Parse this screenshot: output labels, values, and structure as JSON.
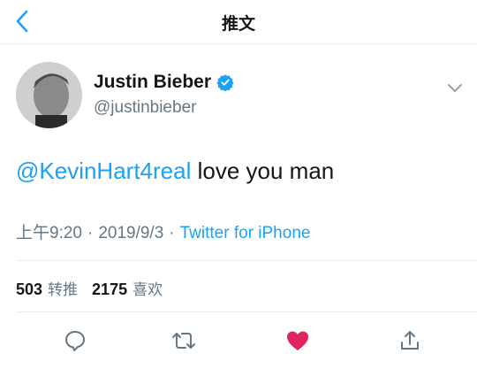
{
  "nav": {
    "title": "推文",
    "back_icon": "chevron-left-icon"
  },
  "author": {
    "name": "Justin Bieber",
    "handle": "@justinbieber",
    "verified": true,
    "verified_color": "#1da1f2"
  },
  "tweet": {
    "mention": "@KevinHart4real",
    "text": " love you man"
  },
  "meta": {
    "time": "上午9:20",
    "separator": "·",
    "date": "2019/9/3",
    "source": "Twitter for iPhone"
  },
  "stats": {
    "retweets": "503",
    "retweets_label": "转推",
    "likes": "2175",
    "likes_label": "喜欢"
  },
  "actions": [
    {
      "icon": "reply-icon"
    },
    {
      "icon": "retweet-icon"
    },
    {
      "icon": "heart-filled-icon",
      "color": "#e0245e"
    },
    {
      "icon": "share-icon"
    }
  ],
  "colors": {
    "accent": "#1da1f2",
    "muted": "#657786",
    "like": "#e0245e"
  }
}
